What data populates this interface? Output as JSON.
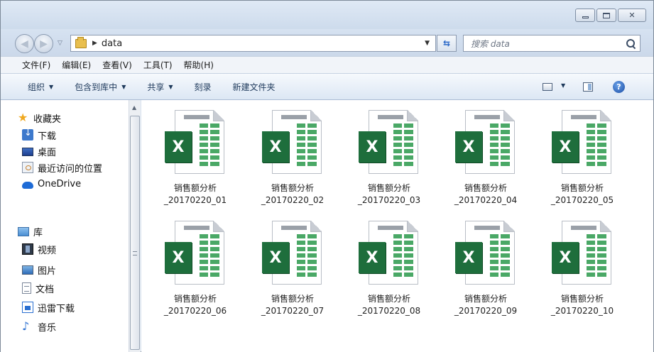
{
  "window": {
    "controls": {
      "minimize": "",
      "maximize": "",
      "close": "✕"
    }
  },
  "address": {
    "path": "data",
    "search_placeholder": "搜索 data"
  },
  "menu": [
    "文件(F)",
    "编辑(E)",
    "查看(V)",
    "工具(T)",
    "帮助(H)"
  ],
  "toolbar": {
    "organize": "组织",
    "include_in_library": "包含到库中",
    "share": "共享",
    "burn": "刻录",
    "new_folder": "新建文件夹",
    "help": "?"
  },
  "navigation": {
    "favorites": {
      "label": "收藏夹",
      "items": [
        "下载",
        "桌面",
        "最近访问的位置",
        "OneDrive"
      ]
    },
    "libraries": {
      "label": "库",
      "items": [
        "视频",
        "图片",
        "文档",
        "迅雷下载",
        "音乐"
      ]
    }
  },
  "files": [
    {
      "name_line1": "销售额分析",
      "name_line2": "_20170220_01"
    },
    {
      "name_line1": "销售额分析",
      "name_line2": "_20170220_02"
    },
    {
      "name_line1": "销售额分析",
      "name_line2": "_20170220_03"
    },
    {
      "name_line1": "销售额分析",
      "name_line2": "_20170220_04"
    },
    {
      "name_line1": "销售额分析",
      "name_line2": "_20170220_05"
    },
    {
      "name_line1": "销售额分析",
      "name_line2": "_20170220_06"
    },
    {
      "name_line1": "销售额分析",
      "name_line2": "_20170220_07"
    },
    {
      "name_line1": "销售额分析",
      "name_line2": "_20170220_08"
    },
    {
      "name_line1": "销售额分析",
      "name_line2": "_20170220_09"
    },
    {
      "name_line1": "销售额分析",
      "name_line2": "_20170220_10"
    }
  ],
  "file_icon_letter": "X",
  "colors": {
    "excel_green": "#1e6e3c",
    "grid_green": "#4aa866",
    "command_text": "#1e395b"
  }
}
